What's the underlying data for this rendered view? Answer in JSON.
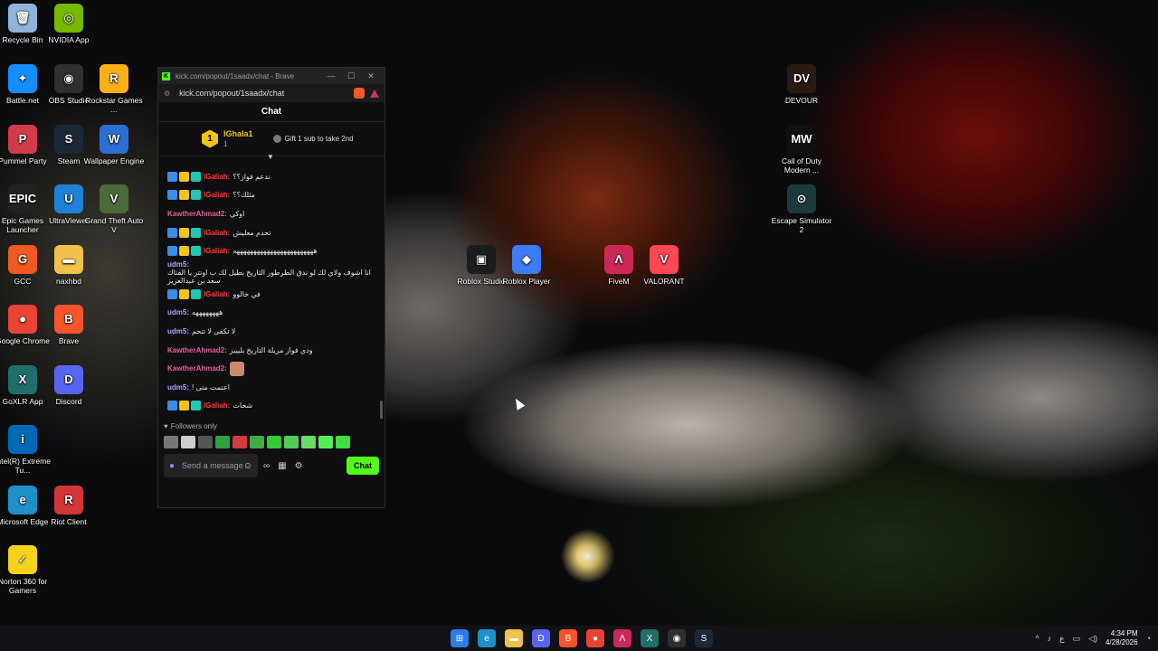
{
  "desktop": {
    "left_icons": [
      {
        "label": "Recycle Bin",
        "color": "#8fb3d9",
        "glyph": "🗑"
      },
      {
        "label": "NVIDIA App",
        "color": "#76b900",
        "glyph": "◎"
      },
      {
        "label": "Battle.net",
        "color": "#148eff",
        "glyph": "✦"
      },
      {
        "label": "OBS Studio",
        "color": "#302e31",
        "glyph": "◉"
      },
      {
        "label": "Rockstar Games ...",
        "color": "#fcaf17",
        "glyph": "R"
      },
      {
        "label": "Pummel Party",
        "color": "#d23b4b",
        "glyph": "P"
      },
      {
        "label": "Steam",
        "color": "#1b2838",
        "glyph": "S"
      },
      {
        "label": "Wallpaper Engine",
        "color": "#2d6fd4",
        "glyph": "W"
      },
      {
        "label": "Epic Games Launcher",
        "color": "#222222",
        "glyph": "EPIC"
      },
      {
        "label": "UltraViewer",
        "color": "#1f82d6",
        "glyph": "U"
      },
      {
        "label": "Grand Theft Auto V",
        "color": "#4b6b3a",
        "glyph": "V"
      },
      {
        "label": "GCC",
        "color": "#f05a22",
        "glyph": "G"
      },
      {
        "label": "naxhbd",
        "color": "#f0c24b",
        "glyph": "▬"
      },
      {
        "label": "Google Chrome",
        "color": "#e84335",
        "glyph": "●"
      },
      {
        "label": "Brave",
        "color": "#fb542b",
        "glyph": "B"
      },
      {
        "label": "GoXLR App",
        "color": "#1f6f6a",
        "glyph": "X"
      },
      {
        "label": "Discord",
        "color": "#5865f2",
        "glyph": "D"
      },
      {
        "label": "Intel(R) Extreme Tu...",
        "color": "#0068b5",
        "glyph": "i"
      },
      {
        "label": "Microsoft Edge",
        "color": "#1e90c8",
        "glyph": "e"
      },
      {
        "label": "Riot Client",
        "color": "#d13639",
        "glyph": "R"
      },
      {
        "label": "Norton 360 for Gamers",
        "color": "#f6d21c",
        "glyph": "✓"
      }
    ],
    "right_icons": [
      {
        "label": "DEVOUR",
        "color": "#2a1a12",
        "glyph": "DV"
      },
      {
        "label": "Call of Duty Modern ...",
        "color": "#111111",
        "glyph": "MW"
      },
      {
        "label": "Escape Simulator 2",
        "color": "#1d3b3b",
        "glyph": "⊙"
      }
    ],
    "middle_icons": [
      {
        "label": "Roblox Studio",
        "color": "#1c1c1c",
        "glyph": "▣"
      },
      {
        "label": "Roblox Player",
        "color": "#3b7bf6",
        "glyph": "◆"
      },
      {
        "label": "FiveM",
        "color": "#cc2857",
        "glyph": "Λ"
      },
      {
        "label": "VALORANT",
        "color": "#ff4655",
        "glyph": "V"
      }
    ]
  },
  "browser": {
    "title": "kick.com/popout/1saadx/chat - Brave",
    "url": "kick.com/popout/1saadx/chat",
    "controls": {
      "minimize": "—",
      "maximize": "☐",
      "close": "✕"
    }
  },
  "chat": {
    "header": "Chat",
    "pinned": {
      "rank": "1",
      "name": "lGhala1",
      "count": "1",
      "gift_text": "Gift 1 sub to take 2nd"
    },
    "messages": [
      {
        "user": "lGaliah",
        "badges": true,
        "class": "u-ig",
        "text": "ندعم فواز؟؟"
      },
      {
        "user": "lGaliah",
        "badges": true,
        "class": "u-ig",
        "text": "مثلك؟؟"
      },
      {
        "user": "KawtherAhmad2",
        "badges": false,
        "class": "u-kw",
        "text": "اوكي"
      },
      {
        "user": "lGaliah",
        "badges": true,
        "class": "u-ig",
        "text": "تحدم معليش"
      },
      {
        "user": "lGaliah",
        "badges": true,
        "class": "u-ig",
        "text": "ههههههههههههههههههههههههه"
      },
      {
        "user": "udm5",
        "badges": false,
        "class": "u-ud",
        "text": "انا اشوف ولاي لك لو ندق الطرطور التاريخ بطيل لك ب اوتتر يا الفتاك سعد بن عبدالعزيز"
      },
      {
        "user": "lGaliah",
        "badges": true,
        "class": "u-ig",
        "text": "في خالوو"
      },
      {
        "user": "udm5",
        "badges": false,
        "class": "u-ud",
        "text": "ههههههههه"
      },
      {
        "user": "udm5",
        "badges": false,
        "class": "u-ud",
        "text": "لا تكفى لا تتحم"
      },
      {
        "user": "KawtherAhmad2",
        "badges": false,
        "class": "u-kw",
        "text": "ودي فواز مزيلة التاريخ بليييز"
      },
      {
        "user": "KawtherAhmad2",
        "badges": false,
        "class": "u-kw",
        "text": "",
        "emote": true
      },
      {
        "user": "udm5",
        "badges": false,
        "class": "u-ud",
        "text": "! اعتمت متى"
      },
      {
        "user": "lGaliah",
        "badges": true,
        "class": "u-ig",
        "text": "شحات"
      }
    ],
    "followers_label": "Followers only",
    "input_placeholder": "Send a message",
    "send_label": "Chat",
    "emote_colors": [
      "#777777",
      "#cccccc",
      "#555555",
      "#2ea043",
      "#d23b3b",
      "#44aa44",
      "#33cc33",
      "#55cc55",
      "#66dd66",
      "#55ee55",
      "#44dd44"
    ]
  },
  "taskbar": {
    "apps": [
      {
        "name": "start",
        "color": "#2b7de9",
        "glyph": "⊞"
      },
      {
        "name": "edge",
        "color": "#1e90c8",
        "glyph": "e"
      },
      {
        "name": "explorer",
        "color": "#f0c24b",
        "glyph": "▬"
      },
      {
        "name": "discord",
        "color": "#5865f2",
        "glyph": "D"
      },
      {
        "name": "brave",
        "color": "#fb542b",
        "glyph": "B"
      },
      {
        "name": "chrome",
        "color": "#e84335",
        "glyph": "●"
      },
      {
        "name": "fivem",
        "color": "#cc2857",
        "glyph": "Λ"
      },
      {
        "name": "goxlr",
        "color": "#1f6f6a",
        "glyph": "X"
      },
      {
        "name": "obs",
        "color": "#302e31",
        "glyph": "◉"
      },
      {
        "name": "steam",
        "color": "#1b2838",
        "glyph": "S"
      }
    ],
    "tray_lang": "ع",
    "time": "4:34 PM",
    "date": "4/28/2026"
  }
}
